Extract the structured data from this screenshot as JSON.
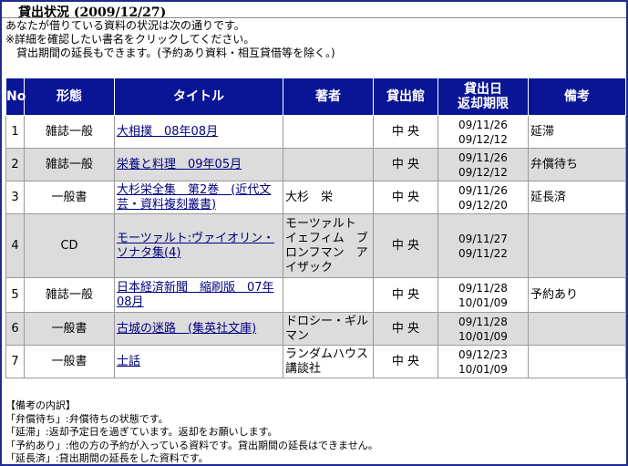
{
  "header": {
    "title": "貸出状況 (2009/12/27)",
    "intro": [
      "あなたが借りている資料の状況は次の通りです。",
      "※詳細を確認したい書名をクリックしてください。",
      "　貸出期間の延長もできます。(予約あり資料・相互貸借等を除く。)"
    ]
  },
  "table": {
    "headers": {
      "no": "No",
      "type": "形態",
      "title": "タイトル",
      "author": "著者",
      "library": "貸出館",
      "date_line1": "貸出日",
      "date_line2": "返却期限",
      "remarks": "備考"
    },
    "rows": [
      {
        "no": "1",
        "type": "雑誌一般",
        "title": "大相撲　08年08月",
        "author": "",
        "library": "中 央",
        "loan_date": "09/11/26",
        "due_date": "09/12/12",
        "remarks": "延滞"
      },
      {
        "no": "2",
        "type": "雑誌一般",
        "title": "栄養と料理　09年05月",
        "author": "",
        "library": "中 央",
        "loan_date": "09/11/26",
        "due_date": "09/12/12",
        "remarks": "弁償待ち"
      },
      {
        "no": "3",
        "type": "一般書",
        "title": "大杉栄全集　第2巻　(近代文芸・資料複刻叢書)",
        "author": "大杉　栄",
        "library": "中 央",
        "loan_date": "09/11/26",
        "due_date": "09/12/20",
        "remarks": "延長済"
      },
      {
        "no": "4",
        "type": "CD",
        "title": "モーツァルト:ヴァイオリン・ソナタ集(4)",
        "author": "モーツァルト　イェフィム　ブロンフマン　アイザック",
        "library": "中 央",
        "loan_date": "09/11/27",
        "due_date": "09/11/22",
        "remarks": ""
      },
      {
        "no": "5",
        "type": "雑誌一般",
        "title": "日本経済新聞　縮刷版　07年08月",
        "author": "",
        "library": "中 央",
        "loan_date": "09/11/28",
        "due_date": "10/01/09",
        "remarks": "予約あり"
      },
      {
        "no": "6",
        "type": "一般書",
        "title": "古城の迷路　(集英社文庫)",
        "author": "ドロシー・ギルマン",
        "library": "中 央",
        "loan_date": "09/11/28",
        "due_date": "10/01/09",
        "remarks": ""
      },
      {
        "no": "7",
        "type": "一般書",
        "title": "士話",
        "author": "ランダムハウス講談社",
        "library": "中 央",
        "loan_date": "09/12/23",
        "due_date": "10/01/09",
        "remarks": ""
      }
    ]
  },
  "notes": {
    "heading": "【備考の内訳】",
    "items": [
      "「弁償待ち」:弁償待ちの状態です。",
      "「延滞」:返却予定日を過ぎています。返却をお願いします。",
      "「予約あり」:他の方の予約が入っている資料です。貸出期間の延長はできません。",
      "「延長済」:貸出期間の延長をした資料です。"
    ]
  }
}
